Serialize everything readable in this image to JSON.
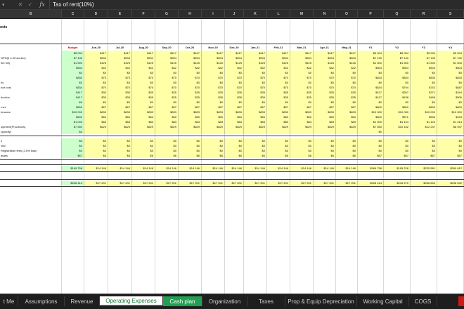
{
  "formula_bar": {
    "content": "Tax of rent(10%)",
    "fx_symbol": "fx",
    "cancel_symbol": "✕",
    "confirm_symbol": "✓"
  },
  "columns": [
    "B",
    "C",
    "D",
    "E",
    "F",
    "G",
    "H",
    "I",
    "J",
    "K",
    "L",
    "M",
    "N",
    "O",
    "P",
    "Q",
    "R",
    "S"
  ],
  "section_title": "osts",
  "header_row": [
    "Budget",
    "Jun-20",
    "Jul-20",
    "Aug-20",
    "Sep-20",
    "Oct-20",
    "Nov-20",
    "Dec-20",
    "Jan-21",
    "Feb-21",
    "Mar-21",
    "Apr-21",
    "May-21",
    "Y1",
    "Y2",
    "Y3",
    "Y4"
  ],
  "rows_a": [
    {
      "label": "",
      "v": [
        "$5 004",
        "$417",
        "$417",
        "$417",
        "$417",
        "$417",
        "$417",
        "$417",
        "$417",
        "$417",
        "$417",
        "$417",
        "$417",
        "$5 004",
        "$5 004",
        "$5 004",
        "$5 004"
      ]
    },
    {
      "label": "NPS@ 4.25 worker)",
      "v": [
        "$7 130",
        "$594",
        "$594",
        "$594",
        "$594",
        "$594",
        "$594",
        "$594",
        "$594",
        "$594",
        "$594",
        "$594",
        "$594",
        "$7 130",
        "$7 130",
        "$7 130",
        "$7 130"
      ]
    },
    {
      "label": "Iter bill)",
      "v": [
        "$1 500",
        "$125",
        "$125",
        "$125",
        "$125",
        "$125",
        "$125",
        "$125",
        "$125",
        "$125",
        "$125",
        "$125",
        "$125",
        "$1 500",
        "$1 500",
        "$1 500",
        "$1 500"
      ]
    },
    {
      "label": "",
      "v": [
        "$504",
        "$42",
        "$42",
        "$42",
        "$42",
        "$42",
        "$42",
        "$42",
        "$42",
        "$42",
        "$42",
        "$42",
        "$42",
        "$504",
        "$504",
        "$504",
        "$504"
      ]
    },
    {
      "label": "",
      "v": [
        "$0",
        "$0",
        "$0",
        "$0",
        "$0",
        "$0",
        "$0",
        "$0",
        "$0",
        "$0",
        "$0",
        "$0",
        "$0",
        "$0",
        "$0",
        "$0",
        "$0"
      ]
    },
    {
      "label": "",
      "v": [
        "$834",
        "$70",
        "$70",
        "$70",
        "$70",
        "$70",
        "$70",
        "$70",
        "$70",
        "$70",
        "$70",
        "$70",
        "$70",
        "$834",
        "$834",
        "$834",
        "$834"
      ]
    },
    {
      "label": "es",
      "v": [
        "$0",
        "$0",
        "$0",
        "$0",
        "$0",
        "$0",
        "$0",
        "$0",
        "$0",
        "$0",
        "$0",
        "$0",
        "$0",
        "$0",
        "$0",
        "$0",
        "$0"
      ]
    },
    {
      "label": "nce cost",
      "v": [
        "$834",
        "$70",
        "$70",
        "$70",
        "$70",
        "$70",
        "$70",
        "$70",
        "$70",
        "$70",
        "$70",
        "$70",
        "$70",
        "$834",
        "$794",
        "$742",
        "$687"
      ]
    },
    {
      "label": "",
      "v": [
        "$417",
        "$35",
        "$35",
        "$35",
        "$35",
        "$35",
        "$35",
        "$35",
        "$35",
        "$35",
        "$35",
        "$35",
        "$35",
        "$417",
        "$397",
        "$371",
        "$344"
      ]
    },
    {
      "label": "duction",
      "v": [
        "$417",
        "$35",
        "$35",
        "$35",
        "$35",
        "$35",
        "$35",
        "$35",
        "$35",
        "$35",
        "$35",
        "$35",
        "$35",
        "$417",
        "$438",
        "$468",
        "$506"
      ]
    },
    {
      "label": "",
      "v": [
        "$0",
        "$0",
        "$0",
        "$0",
        "$0",
        "$0",
        "$0",
        "$0",
        "$0",
        "$0",
        "$0",
        "$0",
        "$0",
        "$0",
        "$0",
        "$0",
        "$0"
      ]
    },
    {
      "label": "rnet",
      "v": [
        "$800",
        "$67",
        "$67",
        "$67",
        "$67",
        "$67",
        "$67",
        "$67",
        "$67",
        "$67",
        "$67",
        "$67",
        "$67",
        "$800",
        "$800",
        "$800",
        "$800"
      ]
    },
    {
      "label": "tenance",
      "v": [
        "$10 000",
        "$833",
        "$833",
        "$833",
        "$833",
        "$833",
        "$833",
        "$833",
        "$833",
        "$833",
        "$833",
        "$833",
        "$833",
        "$10 000",
        "$10 000",
        "$10 000",
        "$10 000"
      ]
    },
    {
      "label": "",
      "v": [
        "$600",
        "$50",
        "$50",
        "$50",
        "$50",
        "$50",
        "$50",
        "$50",
        "$50",
        "$50",
        "$50",
        "$50",
        "$50",
        "$600",
        "$571",
        "$534",
        "$494"
      ]
    },
    {
      "label": "",
      "v": [
        "$1 000",
        "$83",
        "$83",
        "$83",
        "$83",
        "$83",
        "$83",
        "$83",
        "$83",
        "$83",
        "$83",
        "$83",
        "$83",
        "$1 000",
        "$1 104",
        "$1 124",
        "$1 213"
      ]
    },
    {
      "label": "uipment(Provisions)",
      "v": [
        "$7 550",
        "$629",
        "$629",
        "$629",
        "$629",
        "$629",
        "$629",
        "$629",
        "$629",
        "$629",
        "$629",
        "$629",
        "$629",
        "$7 550",
        "$10 152",
        "$12 237",
        "$8 937"
      ]
    },
    {
      "label": "(specify)",
      "v": [
        "$0",
        "",
        "",
        "",
        "",
        "",
        "",
        "",
        "",
        "",
        "",
        "",
        "",
        "$0",
        "",
        "",
        ""
      ]
    }
  ],
  "rows_b": [
    {
      "label": "n",
      "v": [
        "$0",
        "$0",
        "$0",
        "$0",
        "$0",
        "$0",
        "$0",
        "$0",
        "$0",
        "$0",
        "$0",
        "$0",
        "$0",
        "$0",
        "$0",
        "$0",
        "$0"
      ]
    },
    {
      "label": "rest",
      "v": [
        "$0",
        "$0",
        "$0",
        "$0",
        "$0",
        "$0",
        "$0",
        "$0",
        "$0",
        "$0",
        "$0",
        "$0",
        "$0",
        "$0",
        "$0",
        "$0",
        "$0"
      ]
    },
    {
      "label": "Registration fees (2.5% loan)",
      "v": [
        "$0",
        "$0",
        "$0",
        "$0",
        "$0",
        "$0",
        "$0",
        "$0",
        "$0",
        "$0",
        "$0",
        "$0",
        "$0",
        "$0",
        "$0",
        "$0",
        "$0"
      ]
    },
    {
      "label": "arges",
      "v": [
        "$67",
        "$6",
        "$6",
        "$6",
        "$6",
        "$6",
        "$6",
        "$6",
        "$6",
        "$6",
        "$6",
        "$6",
        "$6",
        "$67",
        "$67",
        "$67",
        "$67"
      ]
    }
  ],
  "subtotal_row": {
    "label": "",
    "v": [
      "$169 758",
      "$14 146",
      "$14 146",
      "$14 146",
      "$14 146",
      "$14 146",
      "$14 146",
      "$14 146",
      "$14 146",
      "$14 146",
      "$14 146",
      "$14 146",
      "$14 146",
      "$169 758",
      "$195 228",
      "$225 581",
      "$260 612"
    ]
  },
  "total_row": {
    "label": "",
    "v": [
      "$206 414",
      "$17 201",
      "$17 201",
      "$17 201",
      "$17 201",
      "$17 201",
      "$17 201",
      "$17 201",
      "$17 201",
      "$17 201",
      "$17 201",
      "$17 201",
      "$17 201",
      "$206 414",
      "$234 470",
      "$266 894",
      "$298 632"
    ]
  },
  "sheet_tabs": [
    {
      "label": "t Me",
      "state": "normal"
    },
    {
      "label": "Assumptions",
      "state": "normal"
    },
    {
      "label": "Revenue",
      "state": "normal"
    },
    {
      "label": "Operating Expenses",
      "state": "active"
    },
    {
      "label": "Cash plan",
      "state": "green"
    },
    {
      "label": "Organization",
      "state": "normal"
    },
    {
      "label": "Taxes",
      "state": "normal"
    },
    {
      "label": "Prop & Equip Depreciation",
      "state": "normal"
    },
    {
      "label": "Working Capital",
      "state": "normal"
    },
    {
      "label": "COGS",
      "state": "normal"
    }
  ],
  "colors": {
    "input_yellow": "#ffffa8",
    "calc_green": "#ccffcc",
    "active_tab_text": "#1a7a3a",
    "cash_tab_bg": "#21a052",
    "budget_red": "#c00000"
  }
}
